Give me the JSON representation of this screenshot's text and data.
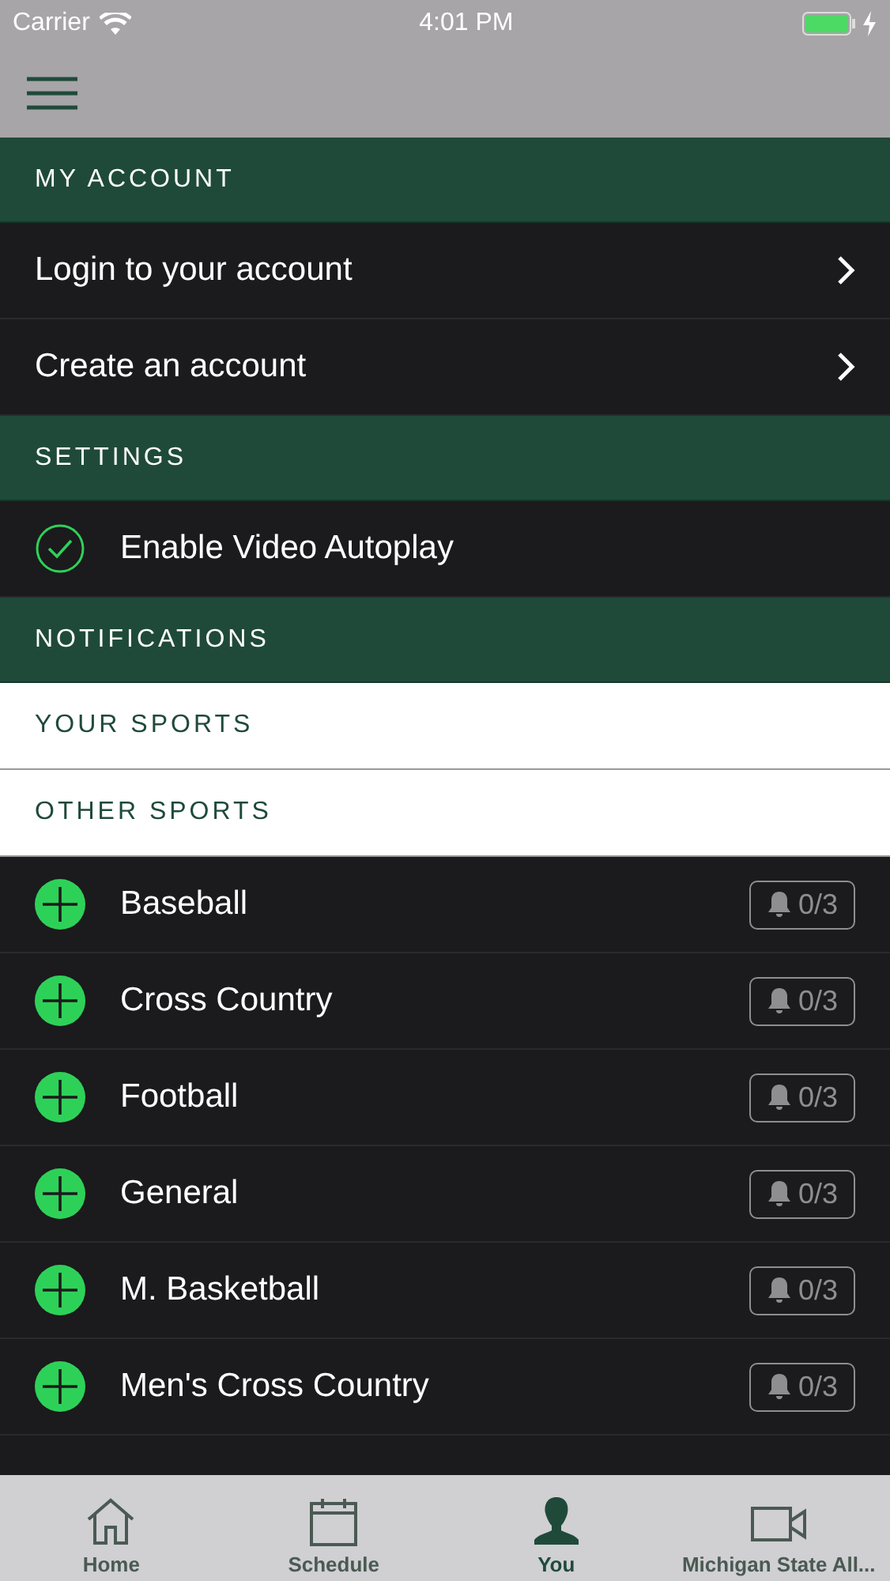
{
  "status_bar": {
    "carrier": "Carrier",
    "time": "4:01 PM"
  },
  "sections": [
    {
      "kind": "header",
      "title": "MY ACCOUNT"
    },
    {
      "kind": "link",
      "label": "Login to your account"
    },
    {
      "kind": "link",
      "label": "Create an account"
    },
    {
      "kind": "header",
      "title": "SETTINGS"
    },
    {
      "kind": "toggle",
      "label": "Enable Video Autoplay",
      "checked": true
    },
    {
      "kind": "header",
      "title": "NOTIFICATIONS"
    },
    {
      "kind": "subheader",
      "title": "YOUR SPORTS"
    },
    {
      "kind": "subheader",
      "title": "OTHER SPORTS"
    },
    {
      "kind": "sport",
      "label": "Baseball",
      "count": "0/3"
    },
    {
      "kind": "sport",
      "label": "Cross Country",
      "count": "0/3"
    },
    {
      "kind": "sport",
      "label": "Football",
      "count": "0/3"
    },
    {
      "kind": "sport",
      "label": "General",
      "count": "0/3"
    },
    {
      "kind": "sport",
      "label": "M. Basketball",
      "count": "0/3"
    },
    {
      "kind": "sport",
      "label": "Men's Cross Country",
      "count": "0/3"
    }
  ],
  "tab_bar": [
    {
      "kind": "home",
      "label": "Home",
      "selected": false
    },
    {
      "kind": "calendar",
      "label": "Schedule",
      "selected": false
    },
    {
      "kind": "person",
      "label": "You",
      "selected": true
    },
    {
      "kind": "video",
      "label": "Michigan State All...",
      "selected": false
    }
  ]
}
